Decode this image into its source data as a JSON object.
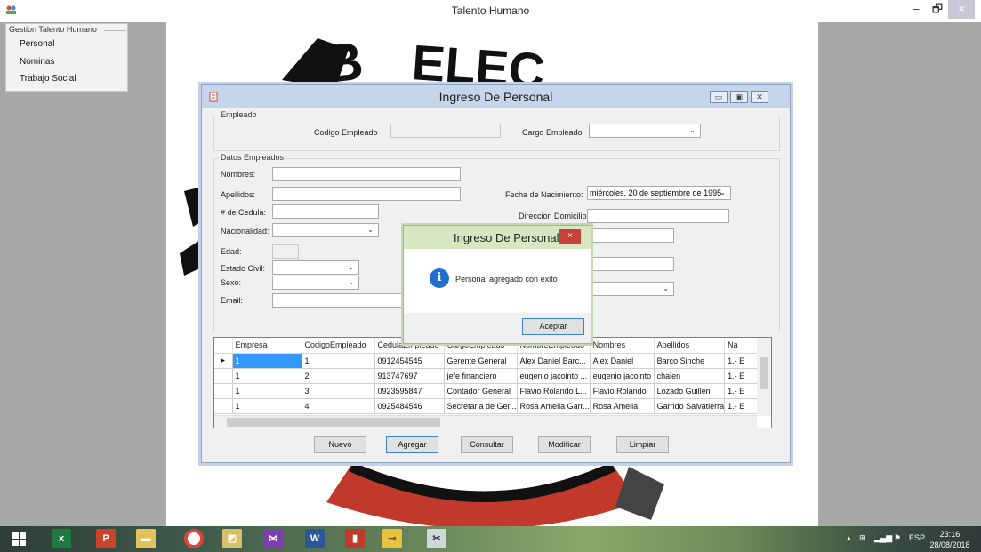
{
  "window": {
    "title": "Talento Humano",
    "controls": {
      "minimize": "–",
      "maximize": "🗗",
      "close": "×"
    }
  },
  "menu": {
    "header": "Gestion Talento Humano",
    "items": [
      {
        "label": "Personal"
      },
      {
        "label": "Nominas"
      },
      {
        "label": "Trabajo Social"
      }
    ]
  },
  "background_logo": {
    "text": "ELEC"
  },
  "dialog": {
    "title": "Ingreso De Personal",
    "empleado_group": {
      "label": "Empleado",
      "codigo_label": "Codigo Empleado",
      "codigo_value": "",
      "cargo_label": "Cargo Empleado",
      "cargo_value": ""
    },
    "datos_group": {
      "label": "Datos Empleados",
      "nombres_label": "Nombres:",
      "apellidos_label": "Apellidos:",
      "cedula_label": "# de Cedula:",
      "nacionalidad_label": "Nacionalidad:",
      "edad_label": "Edad:",
      "estado_civil_label": "Estado Civil:",
      "sexo_label": "Sexo:",
      "email_label": "Email:",
      "fecha_label": "Fecha de Nacimiento:",
      "fecha_value": "miércoles, 20 de septiembre de 1995",
      "direccion_label": "Direccion Domicilio:"
    },
    "grid": {
      "columns": [
        "Empresa",
        "CodigoEmpleado",
        "CedulaEmpleado",
        "CargoEmpleado",
        "NombreEmpleado",
        "Nombres",
        "Apellidos",
        "Na"
      ],
      "rows": [
        [
          "1",
          "1",
          "0912454545",
          "Gerente General",
          "Alex Daniel Barc...",
          "Alex Daniel",
          "Barco Sinche",
          "1.- E"
        ],
        [
          "1",
          "2",
          "913747697",
          "jefe financiero",
          "eugenio jacointo ...",
          "eugenio jacointo",
          "chalen",
          "1.- E"
        ],
        [
          "1",
          "3",
          "0923595847",
          "Contador General",
          "Flavio Rolando L...",
          "Flavio Rolando",
          "Lozado Guillen",
          "1.- E"
        ],
        [
          "1",
          "4",
          "0925484546",
          "Secretaria de Ger...",
          "Rosa Amelia Garr...",
          "Rosa Amelia",
          "Garrido Salvatierra",
          "1.- E"
        ]
      ]
    },
    "buttons": {
      "nuevo": "Nuevo",
      "agregar": "Agregar",
      "consultar": "Consultar",
      "modificar": "Modificar",
      "limpiar": "Limpiar"
    }
  },
  "message_box": {
    "title": "Ingreso De Personal",
    "text": "Personal agregado con exito",
    "ok": "Aceptar",
    "close": "×"
  },
  "taskbar": {
    "language": "ESP",
    "time": "23:16",
    "date": "28/08/2018"
  }
}
